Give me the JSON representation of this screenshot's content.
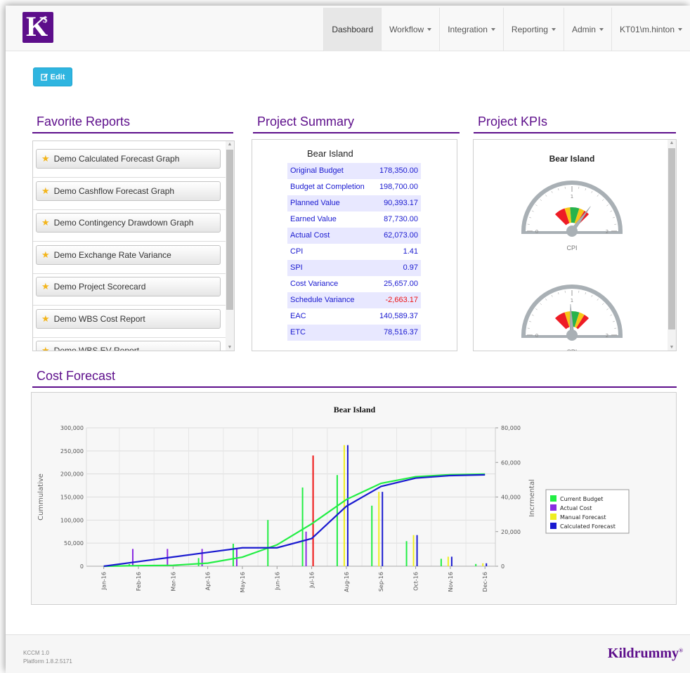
{
  "navbar": {
    "logo_letter": "K",
    "logo_symbol": "$",
    "items": [
      {
        "label": "Dashboard",
        "dropdown": false,
        "active": true
      },
      {
        "label": "Workflow",
        "dropdown": true
      },
      {
        "label": "Integration",
        "dropdown": true
      },
      {
        "label": "Reporting",
        "dropdown": true
      },
      {
        "label": "Admin",
        "dropdown": true
      },
      {
        "label": "KT01\\m.hinton",
        "dropdown": true
      }
    ]
  },
  "edit_button": {
    "label": "Edit",
    "icon": "edit-icon",
    "color": "#2fb5e0"
  },
  "favorite_reports": {
    "title": "Favorite Reports",
    "items": [
      "Demo Calculated Forecast Graph",
      "Demo Cashflow Forecast Graph",
      "Demo Contingency Drawdown Graph",
      "Demo Exchange Rate Variance",
      "Demo Project Scorecard",
      "Demo WBS Cost Report",
      "Demo WBS EV Report"
    ]
  },
  "project_summary": {
    "title": "Project Summary",
    "project": "Bear Island",
    "rows": [
      {
        "label": "Original Budget",
        "value": "178,350.00"
      },
      {
        "label": "Budget at Completion",
        "value": "198,700.00"
      },
      {
        "label": "Planned Value",
        "value": "90,393.17"
      },
      {
        "label": "Earned Value",
        "value": "87,730.00"
      },
      {
        "label": "Actual Cost",
        "value": "62,073.00"
      },
      {
        "label": "CPI",
        "value": "1.41"
      },
      {
        "label": "SPI",
        "value": "0.97"
      },
      {
        "label": "Cost Variance",
        "value": "25,657.00"
      },
      {
        "label": "Schedule Variance",
        "value": "-2,663.17",
        "negative": true
      },
      {
        "label": "EAC",
        "value": "140,589.37"
      },
      {
        "label": "ETC",
        "value": "78,516.37"
      }
    ]
  },
  "project_kpis": {
    "title": "Project KPIs",
    "project": "Bear Island",
    "gauges": [
      {
        "label": "CPI",
        "value": 1.41,
        "min": 0,
        "max": 2,
        "ticks": [
          "0",
          "1",
          "2"
        ]
      },
      {
        "label": "SPI",
        "value": 0.97,
        "min": 0,
        "max": 2,
        "ticks": [
          "0",
          "1",
          "2"
        ]
      }
    ]
  },
  "cost_forecast": {
    "title": "Cost Forecast",
    "chart_data": {
      "type": "bar",
      "title": "Bear Island",
      "ylabel": "Cummulative",
      "y2label": "Incrmental",
      "categories": [
        "Jan-16",
        "Feb-16",
        "Mar-16",
        "Apr-16",
        "May-16",
        "Jun-16",
        "Jul-16",
        "Aug-16",
        "Sep-16",
        "Oct-16",
        "Nov-16",
        "Dec-16"
      ],
      "ylim": [
        0,
        300000
      ],
      "y2lim": [
        0,
        80000
      ],
      "yticks": [
        "0",
        "50,000",
        "100,000",
        "150,000",
        "200,000",
        "250,000",
        "300,000"
      ],
      "y2ticks": [
        "0",
        "20,000",
        "40,000",
        "60,000",
        "80,000"
      ],
      "legend_position": "right",
      "grid": true,
      "series": [
        {
          "name": "Current Budget",
          "axis": "incremental",
          "color": "#22ee44",
          "values": [
            0,
            1200,
            800,
            4700,
            13000,
            26700,
            45500,
            52700,
            35000,
            14500,
            4300,
            1300
          ]
        },
        {
          "name": "Actual Cost",
          "axis": "incremental",
          "color": "#8a2be2",
          "values": [
            0,
            10000,
            10000,
            10000,
            10000,
            0,
            20000,
            0,
            0,
            0,
            0,
            0
          ]
        },
        {
          "name": "Manual Forecast",
          "axis": "incremental",
          "color": "#eeee22",
          "values": [
            0,
            0,
            0,
            0,
            0,
            0,
            0,
            70000,
            43000,
            18000,
            5500,
            1700
          ]
        },
        {
          "name": "Calculated Forecast",
          "axis": "incremental",
          "color": "#1a1ad0",
          "values": [
            0,
            0,
            0,
            0,
            0,
            0,
            0,
            70000,
            43000,
            18000,
            5500,
            1700
          ]
        },
        {
          "name": "Current Budget",
          "axis": "cumulative",
          "color": "#22ee44",
          "values": [
            0,
            1200,
            2000,
            6700,
            19700,
            46400,
            91900,
            144600,
            179600,
            194100,
            198400,
            199700
          ]
        },
        {
          "name": "Calculated Forecast",
          "axis": "cumulative",
          "color": "#1a1ad0",
          "values": [
            0,
            10000,
            20000,
            30000,
            40000,
            40000,
            60000,
            130000,
            173000,
            191000,
            196500,
            198200
          ]
        }
      ],
      "special_bar": {
        "category": "Jul-16",
        "color": "#ee1111",
        "value": 64000
      }
    }
  },
  "footer": {
    "version": "KCCM 1.0",
    "platform": "Platform 1.8.2.5171",
    "brand": "Kildrummy",
    "brand_mark": "®"
  }
}
